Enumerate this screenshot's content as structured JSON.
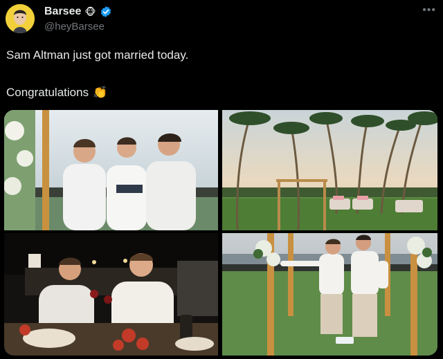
{
  "author": {
    "name": "Barsee",
    "handle": "@heyBarsee",
    "emoji": "🐵"
  },
  "tweet": {
    "line1": "Sam Altman just got married today.",
    "line2": "Congratulations",
    "emoji": "👏"
  },
  "menu_icon": "more-dots-icon",
  "photos": [
    {
      "name": "photo-ceremony-three-men"
    },
    {
      "name": "photo-palm-venue"
    },
    {
      "name": "photo-dinner-toast"
    },
    {
      "name": "photo-glass-stomp"
    }
  ]
}
